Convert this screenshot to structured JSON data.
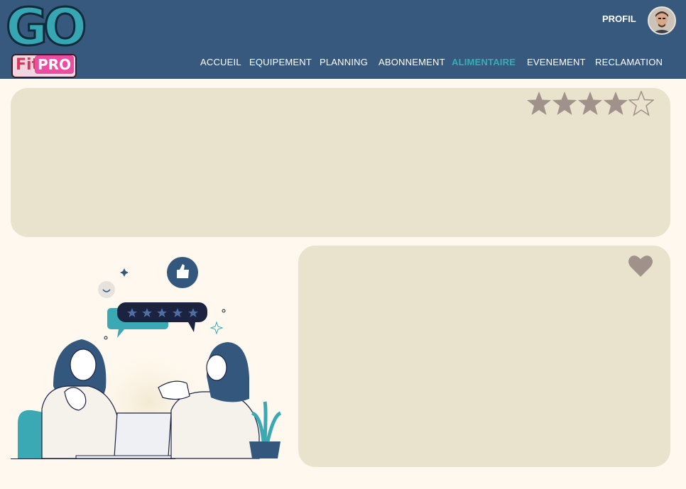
{
  "header": {
    "logo_text": "GO",
    "logo_sub_fit": "Fit",
    "logo_sub_pro": "PRO",
    "profile_label": "PROFIL",
    "nav": [
      {
        "label": "ACCUEIL",
        "active": false
      },
      {
        "label": "EQUIPEMENT",
        "active": false
      },
      {
        "label": "PLANNING",
        "active": false
      },
      {
        "label": "ABONNEMENT",
        "active": false
      },
      {
        "label": "ALIMENTAIRE",
        "active": true
      },
      {
        "label": "EVENEMENT",
        "active": false
      },
      {
        "label": "RECLAMATION",
        "active": false
      }
    ]
  },
  "rating": {
    "value": 4,
    "max": 5,
    "icon": "star-icon",
    "filled_color": "#a0928a",
    "empty_color": "#a0928a"
  },
  "favorite": {
    "icon": "heart-icon",
    "color": "#a0928a"
  },
  "illustration": {
    "icon": "feedback-illustration",
    "review_stars": 5,
    "accent": "#3aa9b4",
    "primary": "#34577d"
  },
  "colors": {
    "header_bg": "#37597d",
    "page_bg": "#fff8ee",
    "card_bg": "#e9e2cc",
    "active_nav": "#35aeb6"
  }
}
